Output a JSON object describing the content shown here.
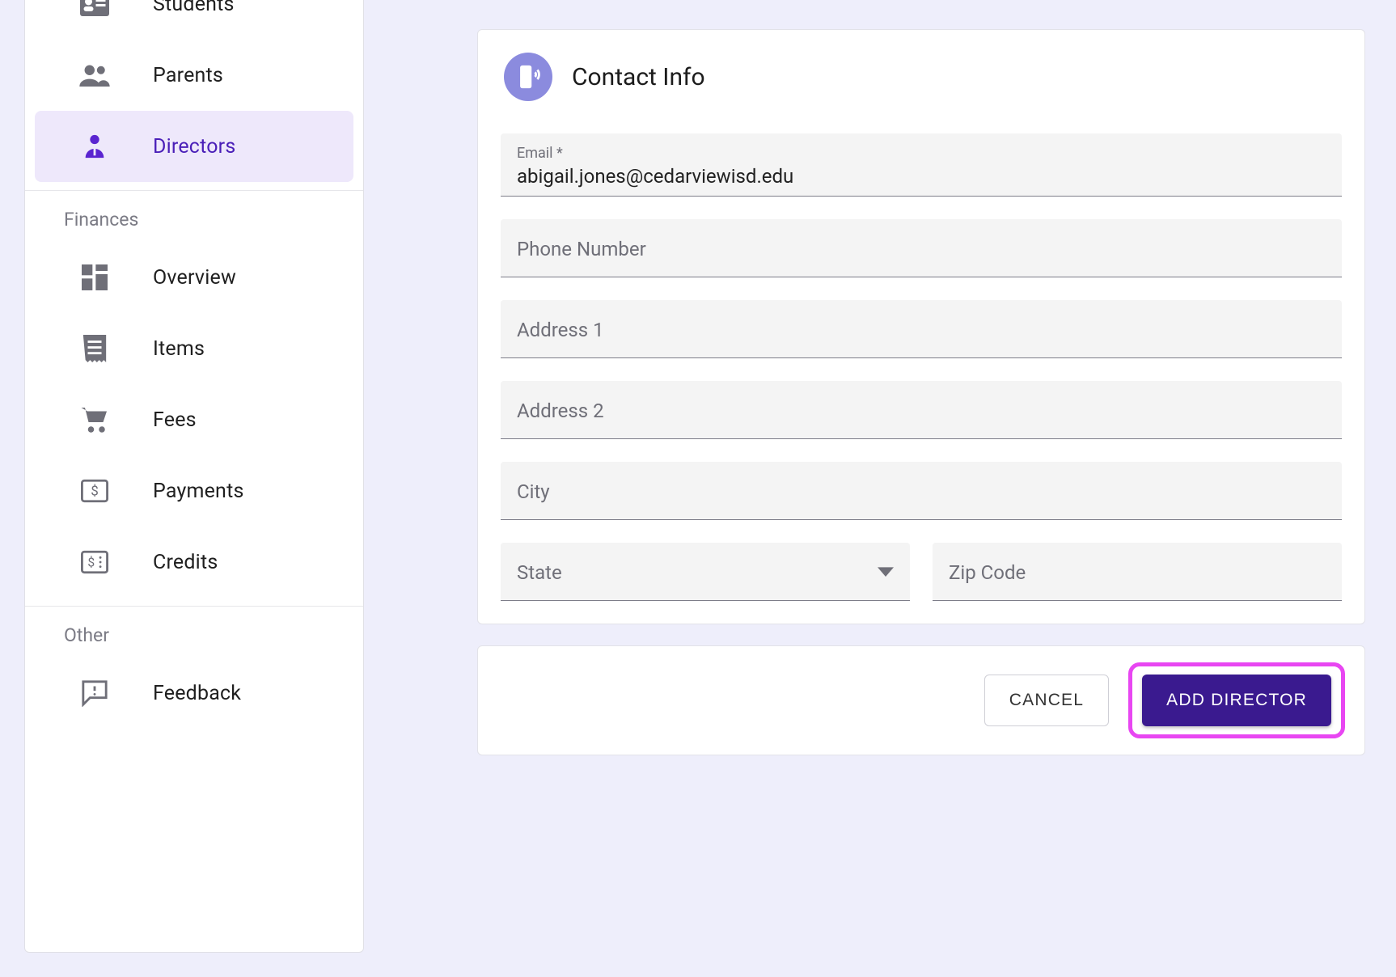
{
  "sidebar": {
    "group_people": [
      {
        "icon": "badge-icon",
        "label": "Students",
        "active": false
      },
      {
        "icon": "people-icon",
        "label": "Parents",
        "active": false
      },
      {
        "icon": "person-tie-icon",
        "label": "Directors",
        "active": true
      }
    ],
    "group_finances_header": "Finances",
    "group_finances": [
      {
        "icon": "dashboard-icon",
        "label": "Overview"
      },
      {
        "icon": "receipt-icon",
        "label": "Items"
      },
      {
        "icon": "cart-icon",
        "label": "Fees"
      },
      {
        "icon": "money-icon",
        "label": "Payments"
      },
      {
        "icon": "credits-icon",
        "label": "Credits"
      }
    ],
    "group_other_header": "Other",
    "group_other": [
      {
        "icon": "feedback-icon",
        "label": "Feedback"
      }
    ]
  },
  "contact_card": {
    "title": "Contact Info",
    "fields": {
      "email": {
        "label": "Email *",
        "value": "abigail.jones@cedarviewisd.edu"
      },
      "phone": {
        "placeholder": "Phone Number"
      },
      "address1": {
        "placeholder": "Address 1"
      },
      "address2": {
        "placeholder": "Address 2"
      },
      "city": {
        "placeholder": "City"
      },
      "state": {
        "placeholder": "State"
      },
      "zip": {
        "placeholder": "Zip Code"
      }
    }
  },
  "actions": {
    "cancel": "CANCEL",
    "submit": "ADD DIRECTOR"
  }
}
